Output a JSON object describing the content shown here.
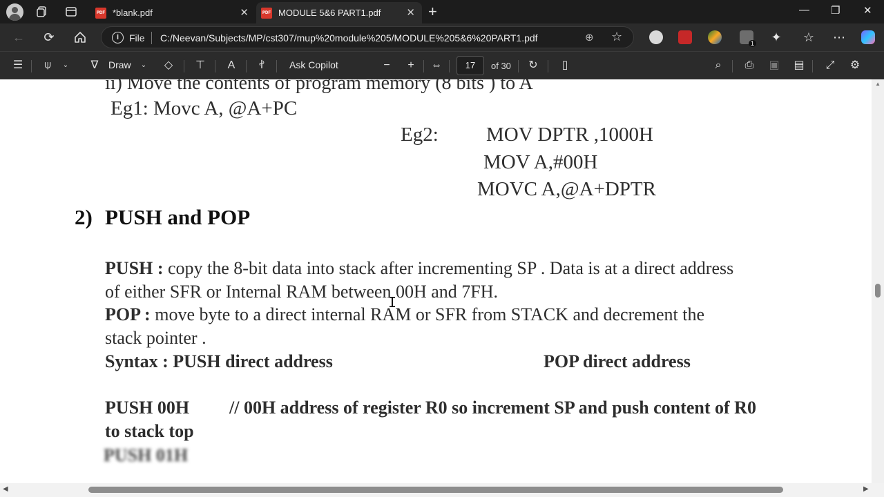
{
  "browser": {
    "tabs": [
      {
        "title": "*blank.pdf",
        "icon": "pdf-icon",
        "active": false
      },
      {
        "title": "MODULE 5&6 PART1.pdf",
        "icon": "pdf-icon",
        "active": true
      }
    ],
    "tab_close_glyph": "✕",
    "new_tab_glyph": "+",
    "window_controls": {
      "minimize": "—",
      "restore": "❐",
      "close": "✕"
    },
    "address": {
      "scheme_label": "File",
      "url": "C:/Neevan/Subjects/MP/cst307/mup%20module%205/MODULE%205&6%20PART1.pdf"
    },
    "extension_badge": "1"
  },
  "pdf_toolbar": {
    "draw_label": "Draw",
    "ask_copilot_label": "Ask Copilot",
    "page_current": "17",
    "page_total_label": "of 30",
    "pdf_badge_text": "PDF"
  },
  "document": {
    "line_cut": "ii)  Move the contents of program memory (8 bits ) to A",
    "eg1": "Eg1: Movc A, @A+PC",
    "eg2_label": "Eg2:",
    "eg2_line1": "MOV DPTR ,1000H",
    "eg2_line2": "MOV A,#00H",
    "eg2_line3": "MOVC A,@A+DPTR",
    "section_number": "2)",
    "section_title": "PUSH and POP",
    "push_term": "PUSH :",
    "push_desc_1": " copy the 8-bit data into stack after incrementing SP  . Data is at a direct address",
    "push_desc_2": "of either SFR or Internal RAM between 00H and 7FH.",
    "pop_term": "POP :",
    "pop_desc_1": "  move byte to a direct internal RAM or SFR from STACK and decrement the",
    "pop_desc_2": "stack pointer .",
    "syntax_push": "Syntax : PUSH  direct address",
    "syntax_pop": "POP direct address",
    "example_instr": "PUSH 00H",
    "example_comment": "// 00H address of register R0 so increment SP and  push content of R0",
    "example_comment_2": "to stack top",
    "blurred_next": "PUSH 01H"
  },
  "colors": {
    "tabstrip_bg": "#1c1c1c",
    "toolbar_bg": "#2b2b2b",
    "pdf_badge": "#d8382c",
    "page_bg": "#ffffff",
    "doc_text": "#2e2e2e"
  }
}
